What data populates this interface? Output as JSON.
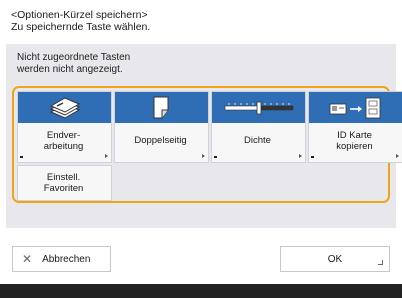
{
  "header": {
    "line1": "<Optionen-Kürzel speichern>",
    "line2": "Zu speichernde Taste wählen."
  },
  "panel": {
    "hint_line1": "Nicht zugeordnete Tasten",
    "hint_line2": "werden nicht angezeigt.",
    "frame_color": "#f0a418",
    "key_color": "#2f6db5",
    "keys": [
      {
        "label": "Endver-\narbeitung",
        "icon": "finishing-icon"
      },
      {
        "label": "Doppelseitig",
        "icon": "two-sided-icon"
      },
      {
        "label": "Dichte",
        "icon": "density-slider-icon"
      },
      {
        "label": "ID Karte\nkopieren",
        "icon": "id-card-copy-icon"
      },
      {
        "label": "Einstell.\nFavoriten"
      }
    ]
  },
  "footer": {
    "cancel_label": "Abbrechen",
    "ok_label": "OK"
  }
}
